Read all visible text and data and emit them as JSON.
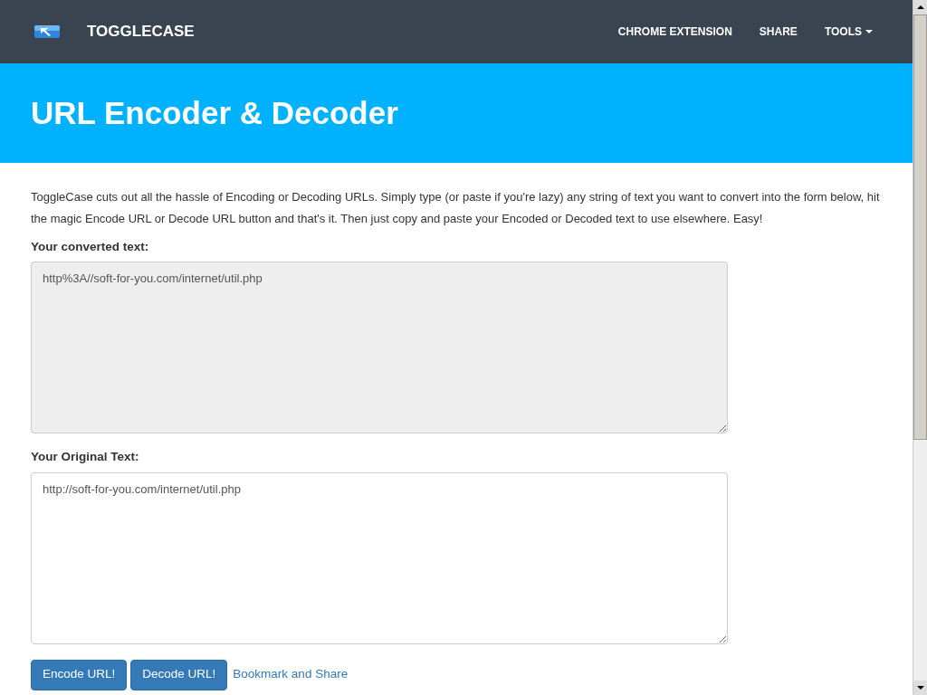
{
  "navbar": {
    "brand": "TOGGLECASE",
    "links": [
      {
        "label": "CHROME EXTENSION",
        "kind": "link"
      },
      {
        "label": "SHARE",
        "kind": "link"
      },
      {
        "label": "TOOLS",
        "kind": "dropdown"
      }
    ]
  },
  "hero": {
    "title": "URL Encoder & Decoder"
  },
  "intro": "ToggleCase cuts out all the hassle of Encoding or Decoding URLs. Simply type (or paste if you're lazy) any string of text you want to convert into the form below, hit the magic Encode URL or Decode URL button and that's it. Then just copy and paste your Encoded or Decoded text to use elsewhere. Easy!",
  "fields": [
    {
      "label": "Your converted text:",
      "value": "http%3A//soft-for-you.com/internet/util.php",
      "readonly": true
    },
    {
      "label": "Your Original Text:",
      "value": "http://soft-for-you.com/internet/util.php",
      "readonly": false
    }
  ],
  "buttons": [
    "Encode URL!",
    "Decode URL!"
  ],
  "link": "Bookmark and Share"
}
